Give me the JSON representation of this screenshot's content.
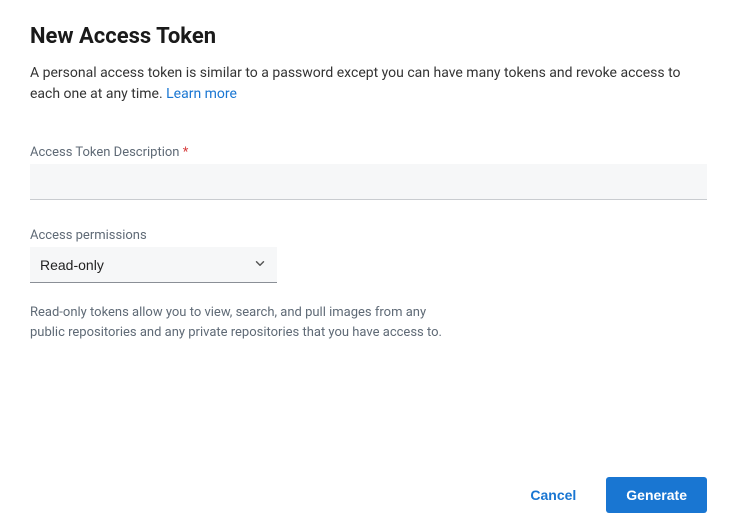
{
  "title": "New Access Token",
  "description": {
    "text": "A personal access token is similar to a password except you can have many tokens and revoke access to each one at any time. ",
    "link_text": "Learn more"
  },
  "form": {
    "description_label": "Access Token Description ",
    "required_marker": "*",
    "description_value": "",
    "permissions_label": "Access permissions",
    "permissions_selected": "Read-only",
    "permissions_helper": "Read-only tokens allow you to view, search, and pull images from any public repositories and any private repositories that you have access to."
  },
  "buttons": {
    "cancel": "Cancel",
    "generate": "Generate"
  }
}
